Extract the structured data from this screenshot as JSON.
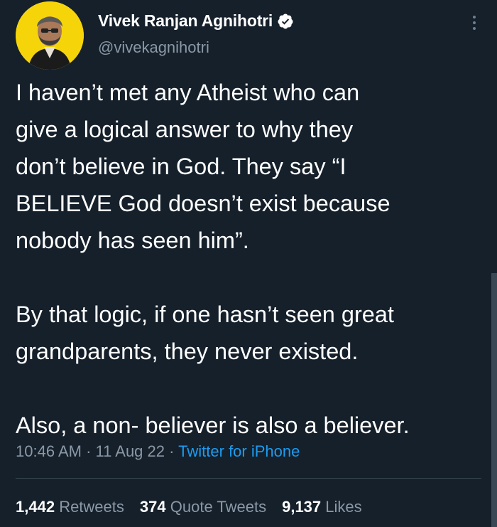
{
  "author": {
    "display_name": "Vivek Ranjan Agnihotri",
    "handle": "@vivekagnihotri",
    "verified": true,
    "avatar_bg": "#f5d50a"
  },
  "tweet": {
    "paragraph_1": [
      "I haven’t met any Atheist who can",
      "give a logical answer to why they",
      "don’t believe in God. They say “I",
      "BELIEVE God doesn’t exist because",
      "nobody has seen him”."
    ],
    "paragraph_2": [
      "By that logic, if one hasn’t seen great",
      "grandparents, they never existed."
    ],
    "paragraph_3": [
      "Also, a non- believer is also a believer."
    ]
  },
  "meta": {
    "time": "10:46 AM",
    "separator": "·",
    "date": "11 Aug 22",
    "source": "Twitter for iPhone"
  },
  "stats": {
    "retweets_count": "1,442",
    "retweets_label": "Retweets",
    "quotes_count": "374",
    "quotes_label": "Quote Tweets",
    "likes_count": "9,137",
    "likes_label": "Likes"
  },
  "colors": {
    "background": "#15202b",
    "secondary_text": "#8b98a5",
    "link": "#1d9bf0",
    "verified_badge": "#ffffff"
  },
  "icons": [
    "verified-badge-icon",
    "more-options-icon"
  ]
}
